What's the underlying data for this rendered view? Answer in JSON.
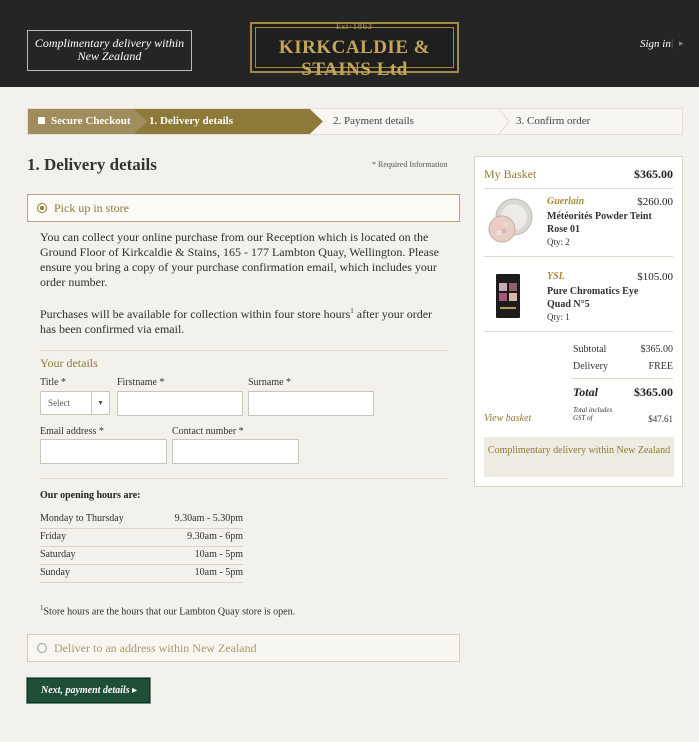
{
  "header": {
    "promo": "Complimentary delivery within New Zealand",
    "logo_est": "Est·1863",
    "logo_name": "KIRKCALDIE & STAINS Ltd",
    "signin": "Sign in",
    "signin_sep": "|",
    "signin_arrow": "▸"
  },
  "progress": {
    "secure": "Secure Checkout",
    "step1": "1. Delivery details",
    "step2": "2. Payment details",
    "step3": "3. Confirm order"
  },
  "form": {
    "title": "1. Delivery details",
    "required_note": "* Required Information",
    "pickup_label": "Pick up in store",
    "para1": "You can collect your online purchase from our Reception which is located on the Ground Floor of Kirkcaldie & Stains, 165 - 177 Lambton Quay, Wellington. Please ensure you bring a copy of your purchase confirmation email, which includes your order number.",
    "para2_a": "Purchases will be available for collection within four store hours",
    "para2_sup": "1",
    "para2_b": " after your order has been confirmed via email.",
    "your_details": "Your details",
    "title_label": "Title *",
    "title_value": "Select",
    "firstname_label": "Firstname *",
    "surname_label": "Surname *",
    "email_label": "Email address *",
    "contact_label": "Contact number *",
    "hours_title": "Our opening hours are:",
    "hours": [
      {
        "day": "Monday to Thursday",
        "time": "9.30am - 5.30pm"
      },
      {
        "day": "Friday",
        "time": "9.30am - 6pm"
      },
      {
        "day": "Saturday",
        "time": "10am - 5pm"
      },
      {
        "day": "Sunday",
        "time": "10am - 5pm"
      }
    ],
    "footnote_sup": "1",
    "footnote": "Store hours are the hours that our Lambton Quay store is open.",
    "deliver_label": "Deliver to an address within New Zealand",
    "next_button": "Next, payment details ▸"
  },
  "basket": {
    "title": "My Basket",
    "total_top": "$365.00",
    "items": [
      {
        "brand": "Guerlain",
        "price": "$260.00",
        "name": "Météorités Powder Teint Rose 01",
        "qty": "Qty: 2"
      },
      {
        "brand": "YSL",
        "price": "$105.00",
        "name": "Pure Chromatics Eye Quad N°5",
        "qty": "Qty: 1"
      }
    ],
    "subtotal_label": "Subtotal",
    "subtotal_value": "$365.00",
    "delivery_label": "Delivery",
    "delivery_value": "FREE",
    "total_label": "Total",
    "total_value": "$365.00",
    "view_basket": "View basket",
    "gst_label": "Total includes GST of",
    "gst_value": "$47.61",
    "promo": "Complimentary delivery within New Zealand"
  },
  "colors": {
    "gold": "#8e7a38",
    "header_bg": "#252525",
    "button_green": "#1f4f36"
  }
}
